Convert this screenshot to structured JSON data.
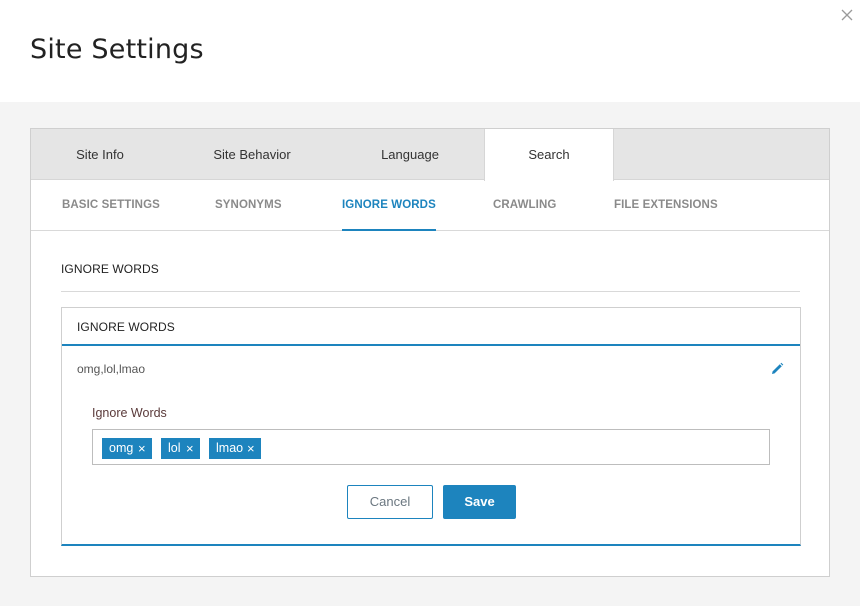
{
  "header": {
    "title": "Site Settings",
    "close_icon": "close-icon"
  },
  "tabs": [
    {
      "label": "Site Info",
      "active": false
    },
    {
      "label": "Site Behavior",
      "active": false
    },
    {
      "label": "Language",
      "active": false
    },
    {
      "label": "Search",
      "active": true
    }
  ],
  "subtabs": [
    {
      "label": "BASIC SETTINGS",
      "active": false
    },
    {
      "label": "SYNONYMS",
      "active": false
    },
    {
      "label": "IGNORE WORDS",
      "active": true
    },
    {
      "label": "CRAWLING",
      "active": false
    },
    {
      "label": "FILE EXTENSIONS",
      "active": false
    }
  ],
  "section": {
    "title": "IGNORE WORDS"
  },
  "card": {
    "title": "IGNORE WORDS",
    "current_value": "omg,lol,lmao",
    "edit_icon": "pencil-icon",
    "field_label": "Ignore Words",
    "tags": [
      {
        "text": "omg",
        "remove": "×"
      },
      {
        "text": "lol",
        "remove": "×"
      },
      {
        "text": "lmao",
        "remove": "×"
      }
    ],
    "cancel_label": "Cancel",
    "save_label": "Save"
  },
  "colors": {
    "accent": "#1d84be",
    "tab_bar": "#e5e5e5",
    "page_bg": "#f4f4f4"
  }
}
